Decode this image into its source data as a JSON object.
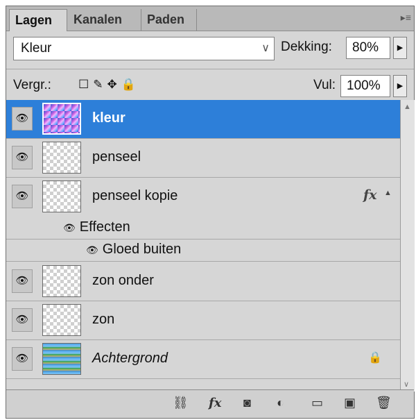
{
  "tabs": [
    {
      "label": "Lagen",
      "active": true
    },
    {
      "label": "Kanalen",
      "active": false
    },
    {
      "label": "Paden",
      "active": false
    }
  ],
  "blend_mode": "Kleur",
  "opacity": {
    "label": "Dekking:",
    "value": "80%"
  },
  "lock": {
    "label": "Vergr.:"
  },
  "fill": {
    "label": "Vul:",
    "value": "100%"
  },
  "layers": [
    {
      "name": "kleur",
      "selected": true
    },
    {
      "name": "penseel"
    },
    {
      "name": "penseel kopie",
      "fx": "fx"
    },
    {
      "effects_label": "Effecten",
      "effect_name": "Gloed buiten"
    },
    {
      "name": "zon onder"
    },
    {
      "name": "zon"
    },
    {
      "name": "Achtergrond",
      "locked": true
    }
  ],
  "colors": {
    "selection": "#2d7fd9",
    "panel": "#d6d6d6"
  }
}
